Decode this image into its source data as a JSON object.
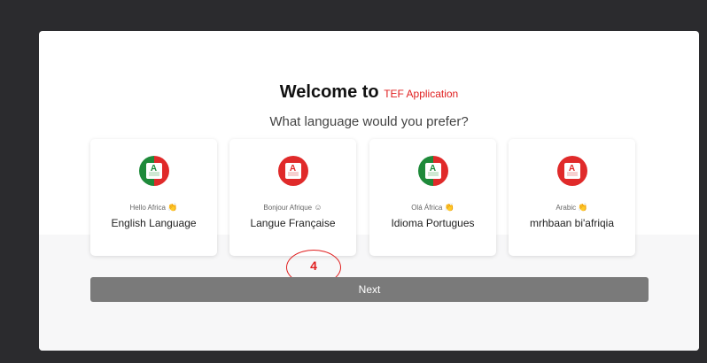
{
  "welcome": {
    "title_prefix": "Welcome to",
    "brand": "TEF Application",
    "subtitle": "What language would you prefer?"
  },
  "languages": [
    {
      "greeting": "Hello Africa",
      "emoji": "👏",
      "label": "English Language",
      "flag_letter": "A",
      "flag_icon": "flag-icon"
    },
    {
      "greeting": "Bonjour Afrique",
      "emoji": "☺",
      "label": "Langue Française",
      "flag_letter": "A",
      "flag_icon": "flag-icon"
    },
    {
      "greeting": "Olá África",
      "emoji": "👏",
      "label": "Idioma Portugues",
      "flag_letter": "A",
      "flag_icon": "flag-icon"
    },
    {
      "greeting": "Arabic",
      "emoji": "👏",
      "label": "mrhbaan bi'afriqia",
      "flag_letter": "A",
      "flag_icon": "flag-icon"
    }
  ],
  "annotation": {
    "label": "4",
    "color": "#e02020"
  },
  "next_button": {
    "label": "Next",
    "color": "#7a7a7a"
  },
  "colors": {
    "brand": "#e02020",
    "green": "#1e8a3a",
    "red": "#e02a2a"
  }
}
